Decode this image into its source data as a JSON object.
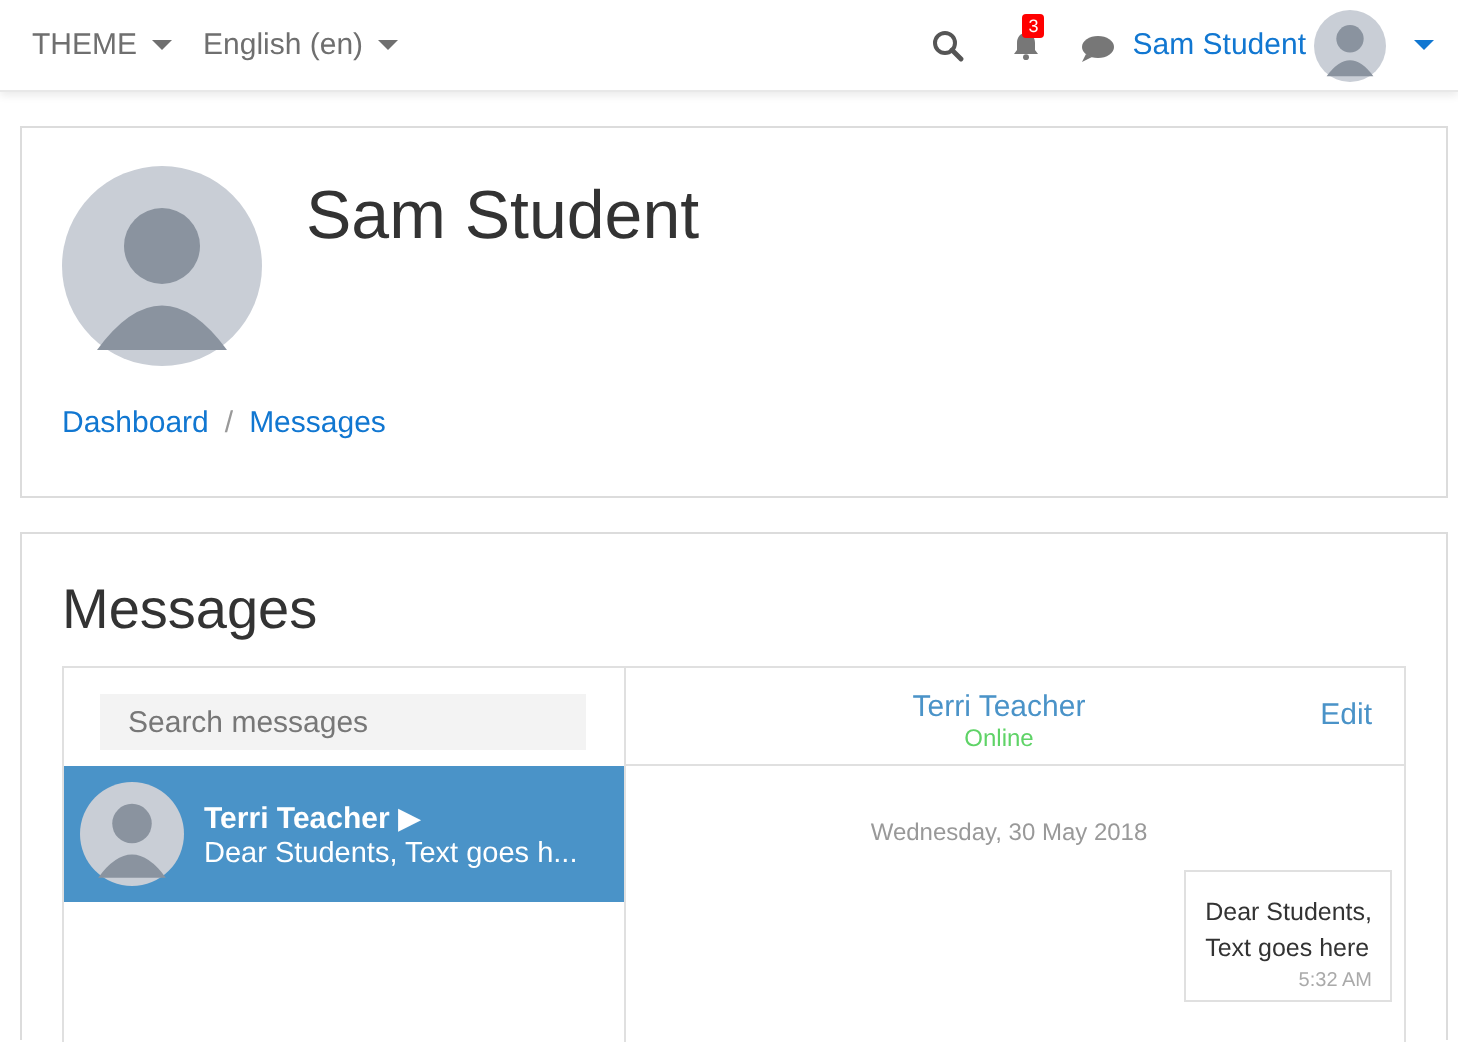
{
  "navbar": {
    "menus": [
      {
        "label": "THEME"
      },
      {
        "label": "English (en)"
      }
    ],
    "notification_count": "3",
    "user_name": "Sam Student"
  },
  "profile": {
    "name": "Sam Student",
    "separator": "/",
    "breadcrumbs": [
      {
        "label": "Dashboard"
      },
      {
        "label": "Messages"
      }
    ]
  },
  "messages": {
    "title": "Messages",
    "search": {
      "placeholder": "Search messages"
    },
    "contacts": [
      {
        "name": "Terri Teacher ▶",
        "preview": "Dear Students, Text goes h...",
        "selected": true
      }
    ],
    "conversation": {
      "contact": "Terri Teacher",
      "status": "Online",
      "edit": "Edit",
      "date": "Wednesday, 30 May 2018",
      "messages": [
        {
          "lines": [
            "Dear Students,",
            "Text goes here"
          ],
          "time": "5:32 AM"
        }
      ]
    }
  }
}
